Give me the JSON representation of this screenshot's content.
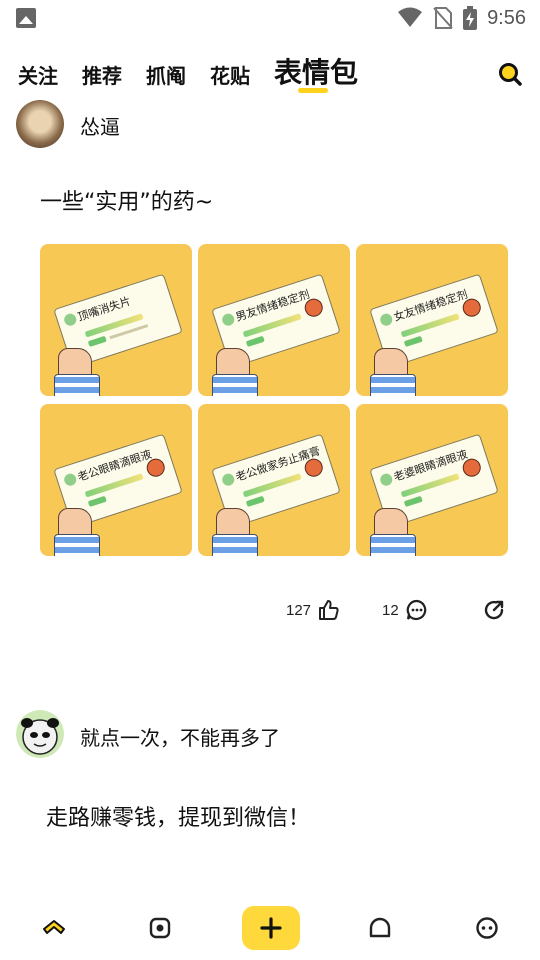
{
  "status_bar": {
    "time": "9:56",
    "icons": [
      "gallery-icon",
      "wifi-icon",
      "no-sim-icon",
      "battery-charging-icon"
    ]
  },
  "top_tabs": {
    "items": [
      {
        "label": "关注"
      },
      {
        "label": "推荐"
      },
      {
        "label": "抓阄"
      },
      {
        "label": "花贴"
      },
      {
        "label": "表情包"
      }
    ],
    "active_index": 4,
    "search_icon": "search-icon",
    "accent_color": "#ffd21f"
  },
  "posts": [
    {
      "username": "怂逼",
      "text": "一些“实用”的药~",
      "images": [
        {
          "label": "顶嘴消失片"
        },
        {
          "label": "男友情绪稳定剂"
        },
        {
          "label": "女友情绪稳定剂"
        },
        {
          "label": "老公眼睛滴眼液"
        },
        {
          "label": "老公做家务止痛膏"
        },
        {
          "label": "老婆眼睛滴眼液"
        }
      ],
      "likes": "127",
      "comments": "12",
      "icons": [
        "like-icon",
        "comment-icon",
        "share-icon"
      ]
    },
    {
      "username": "就点一次，不能再多了",
      "text": "走路赚零钱，提现到微信！"
    }
  ],
  "bottom_nav": {
    "items": [
      "home-icon",
      "discover-icon",
      "publish-icon",
      "notification-icon",
      "profile-icon"
    ],
    "publish_color": "#ffd93b"
  }
}
